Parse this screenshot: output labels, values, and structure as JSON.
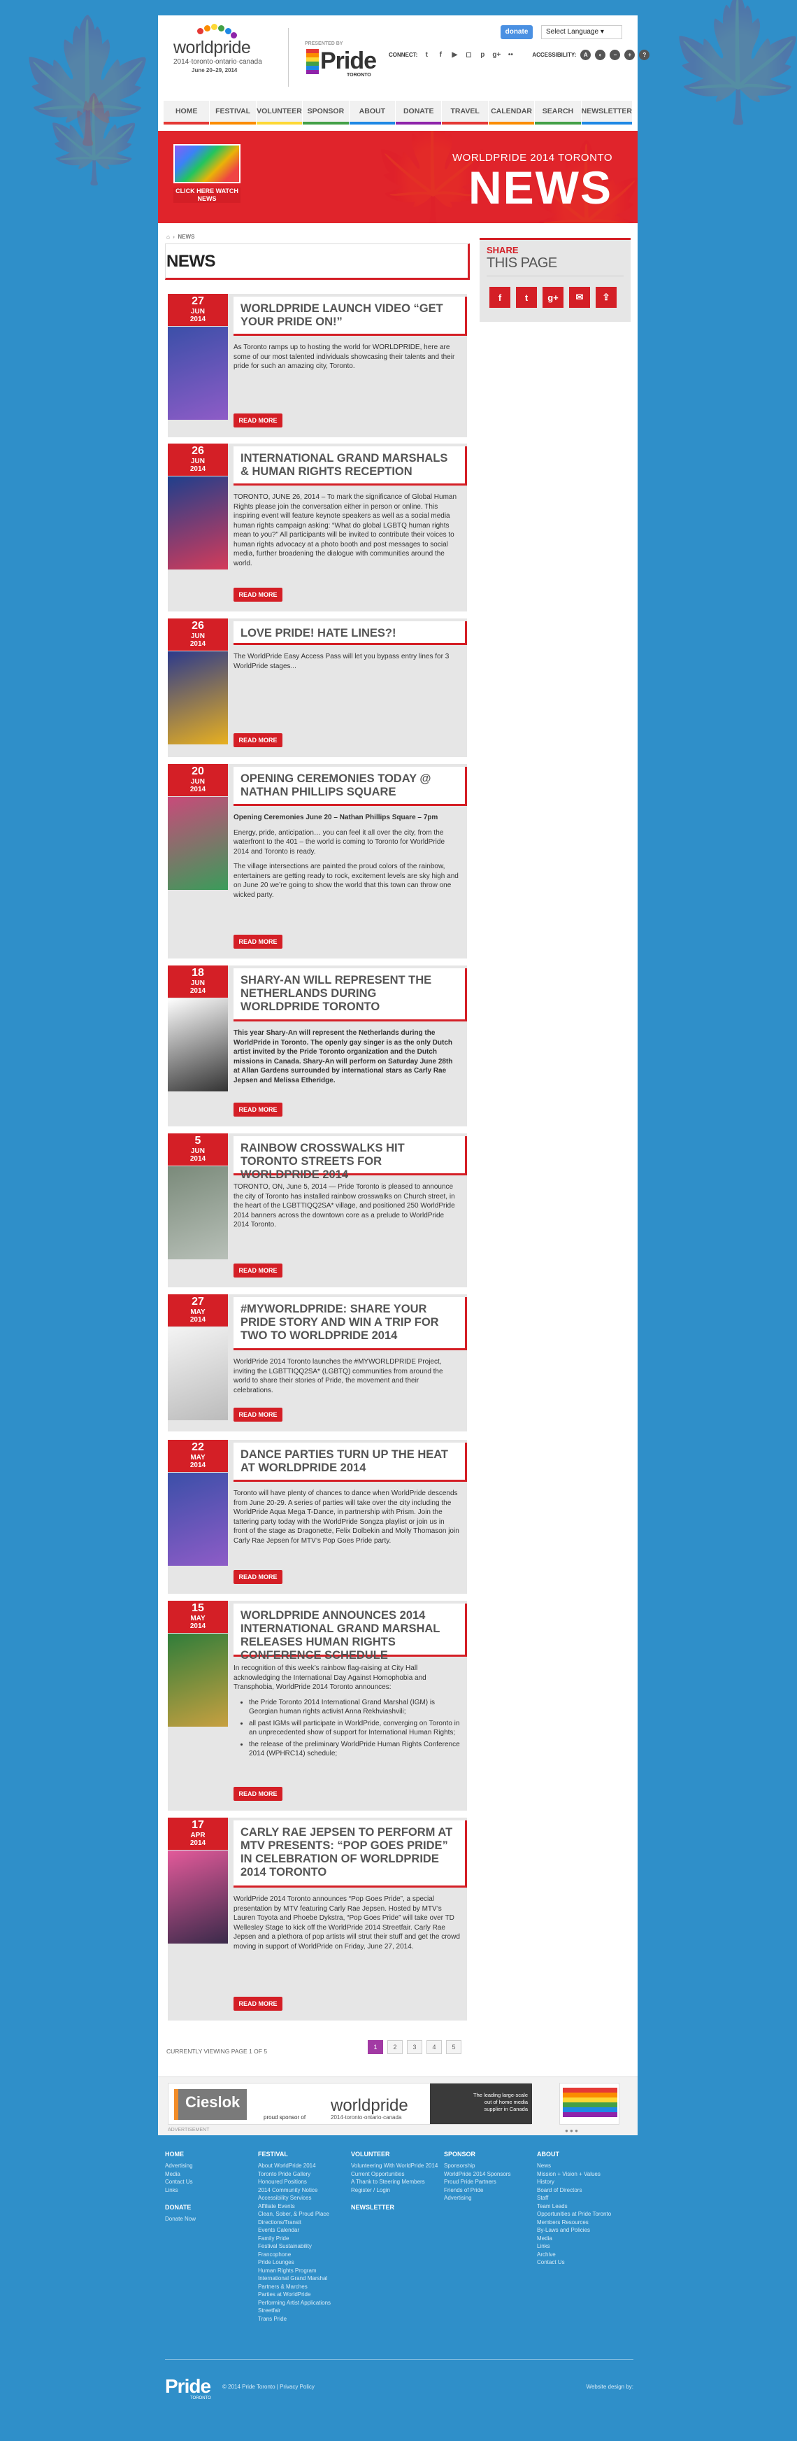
{
  "header": {
    "logo_text": "worldpride",
    "logo_sub": "2014·toronto·ontario·canada",
    "logo_dates": "June 20–29, 2014",
    "presented_by": "PRESENTED BY",
    "pride_logo": "Pride",
    "pride_logo_sub": "TORONTO",
    "donate_label": "donate",
    "language_label": "Select Language",
    "connect_label": "CONNECT:",
    "accessibility_label": "ACCESSIBILITY:"
  },
  "nav": [
    "HOME",
    "FESTIVAL",
    "VOLUNTEER",
    "SPONSOR",
    "ABOUT",
    "DONATE",
    "TRAVEL",
    "CALENDAR",
    "SEARCH",
    "NEWSLETTER"
  ],
  "nav_colors": [
    "#e53935",
    "#fb8c00",
    "#fdd835",
    "#43a047",
    "#1e88e5",
    "#8e24aa",
    "#e53935",
    "#fb8c00",
    "#43a047",
    "#1e88e5"
  ],
  "hero": {
    "kicker": "WORLDPRIDE 2014 TORONTO",
    "title": "NEWS",
    "video_label": "CLICK HERE WATCH NEWS"
  },
  "breadcrumb": "NEWS",
  "page_title": "NEWS",
  "share": {
    "line1": "SHARE",
    "line2": "THIS PAGE",
    "icons": [
      "f",
      "t",
      "g+",
      "✉",
      "⇪"
    ]
  },
  "articles": [
    {
      "day": "27",
      "month": "JUN",
      "year": "2014",
      "title": "WORLDPRIDE LAUNCH VIDEO “GET YOUR PRIDE ON!”",
      "body": [
        "As Toronto ramps up to hosting the world for WORLDPRIDE, here are some of our most talented individuals showcasing their talents and their pride for such an amazing city, Toronto."
      ],
      "read_more": "READ MORE"
    },
    {
      "day": "26",
      "month": "JUN",
      "year": "2014",
      "title": "INTERNATIONAL GRAND MARSHALS & HUMAN RIGHTS RECEPTION",
      "body": [
        "TORONTO, JUNE 26, 2014 – To mark the significance of Global Human Rights please join the conversation either in person or online. This inspiring event will feature keynote speakers as well as a social media human rights campaign asking: “What do global LGBTQ human rights mean to you?” All participants will be invited to contribute their voices to human rights advocacy at a photo booth and post messages to social media, further broadening the dialogue with communities around the world."
      ],
      "read_more": "READ MORE"
    },
    {
      "day": "26",
      "month": "JUN",
      "year": "2014",
      "title": "LOVE PRIDE! HATE LINES?!",
      "body": [
        "The WorldPride Easy Access Pass will let you bypass entry lines for 3 WorldPride stages..."
      ],
      "read_more": "READ MORE"
    },
    {
      "day": "20",
      "month": "JUN",
      "year": "2014",
      "title": "OPENING CEREMONIES TODAY @ NATHAN PHILLIPS SQUARE",
      "body": [
        "Opening Ceremonies June 20 – Nathan Phillips Square – 7pm",
        "Energy, pride, anticipation… you can feel it all over the city, from the waterfront to the 401 – the world is coming to Toronto for WorldPride 2014 and Toronto is ready.",
        "The village intersections are painted the proud colors of the rainbow, entertainers are getting ready to rock, excitement levels are sky high and on June 20 we’re going to show the world that this town can throw one wicked party."
      ],
      "read_more": "READ MORE"
    },
    {
      "day": "18",
      "month": "JUN",
      "year": "2014",
      "title": "SHARY-AN WILL REPRESENT THE NETHERLANDS DURING WORLDPRIDE TORONTO",
      "body": [
        "This year Shary-An will represent the Netherlands during the WorldPride in Toronto. The openly gay singer is as the only Dutch artist invited by the Pride Toronto organization and the Dutch missions in Canada. Shary-An will perform on Saturday June 28th at Allan Gardens surrounded by international stars as Carly Rae Jepsen and Melissa Etheridge."
      ],
      "read_more": "READ MORE"
    },
    {
      "day": "5",
      "month": "JUN",
      "year": "2014",
      "title": "RAINBOW CROSSWALKS HIT TORONTO STREETS FOR WORLDPRIDE 2014",
      "body": [
        "TORONTO, ON, June 5, 2014 — Pride Toronto is pleased to announce the city of Toronto has installed rainbow crosswalks on Church street, in the heart of the LGBTTIQQ2SA* village, and positioned 250 WorldPride 2014 banners across the downtown core as a prelude to WorldPride 2014 Toronto."
      ],
      "read_more": "READ MORE"
    },
    {
      "day": "27",
      "month": "MAY",
      "year": "2014",
      "title": "#MYWORLDPRIDE: SHARE YOUR PRIDE STORY AND WIN A TRIP FOR TWO TO WORLDPRIDE 2014",
      "body": [
        "WorldPride 2014 Toronto launches the #MYWORLDPRIDE Project, inviting the LGBTTIQQ2SA* (LGBTQ) communities from around the world to share their stories of Pride, the movement and their celebrations."
      ],
      "read_more": "READ MORE"
    },
    {
      "day": "22",
      "month": "MAY",
      "year": "2014",
      "title": "DANCE PARTIES TURN UP THE HEAT AT WORLDPRIDE 2014",
      "body": [
        "Toronto will have plenty of chances to dance when WorldPride descends from June 20-29. A series of parties will take over the city including the WorldPride Aqua Mega T-Dance, in partnership with Prism. Join the tattering party today with the WorldPride Songza playlist or join us in front of the stage as Dragonette, Felix Dolbekin and Molly Thomason join Carly Rae Jepsen for MTV’s Pop Goes Pride party."
      ],
      "read_more": "READ MORE"
    },
    {
      "day": "15",
      "month": "MAY",
      "year": "2014",
      "title": "WORLDPRIDE ANNOUNCES 2014 INTERNATIONAL GRAND MARSHAL RELEASES HUMAN RIGHTS CONFERENCE SCHEDULE",
      "body": [
        "In recognition of this week’s rainbow flag-raising at City Hall acknowledging the International Day Against Homophobia and Transphobia, WorldPride 2014 Toronto announces:"
      ],
      "bullets": [
        "the Pride Toronto 2014 International Grand Marshal (IGM) is Georgian human rights activist Anna Rekhviashvili;",
        "all past IGMs will participate in WorldPride, converging on Toronto in an unprecedented show of support for International Human Rights;",
        "the release of the preliminary WorldPride Human Rights Conference 2014 (WPHRC14) schedule;"
      ],
      "read_more": "READ MORE"
    },
    {
      "day": "17",
      "month": "APR",
      "year": "2014",
      "title": "CARLY RAE JEPSEN TO PERFORM AT MTV PRESENTS: “POP GOES PRIDE” IN CELEBRATION OF WORLDPRIDE 2014 TORONTO",
      "body": [
        "WorldPride 2014 Toronto announces “Pop Goes Pride”, a special presentation by MTV featuring Carly Rae Jepsen. Hosted by MTV’s Lauren Toyota and Phoebe Dykstra, “Pop Goes Pride” will take over TD Wellesley Stage to kick off the WorldPride 2014 Streetfair. Carly Rae Jepsen and a plethora of pop artists will strut their stuff and get the crowd moving in support of WorldPride on Friday, June 27, 2014."
      ],
      "read_more": "READ MORE"
    }
  ],
  "pager": {
    "label": "CURRENTLY VIEWING PAGE 1 OF 5",
    "pages": [
      "1",
      "2",
      "3",
      "4",
      "5"
    ],
    "current": "1"
  },
  "ads": {
    "sponsor": "Cieslok",
    "sponsor_sub": "media",
    "proud": "proud sponsor of",
    "wp": "worldpride",
    "wp_sub": "2014·toronto·ontario·canada",
    "tagline": "The leading large-scale out of home media supplier in Canada",
    "advert_label": "ADVERTISEMENT"
  },
  "footer": {
    "cols": [
      {
        "title": "HOME",
        "items": [
          "Advertising",
          "Media",
          "Contact Us",
          "Links"
        ],
        "title2": "DONATE",
        "items2": [
          "Donate Now"
        ]
      },
      {
        "title": "FESTIVAL",
        "items": [
          "About WorldPride 2014",
          "Toronto Pride Gallery",
          "Honoured Positions",
          "2014 Community Notice",
          "Accessibility Services",
          "Affiliate Events",
          "Clean, Sober, & Proud Place",
          "Directions/Transit",
          "Events Calendar",
          "Family Pride",
          "Festival Sustainability",
          "Francophone",
          "Pride Lounges",
          "Human Rights Program",
          "International Grand Marshal",
          "Partners & Marches",
          "Parties at WorldPride",
          "Performing Artist Applications",
          "Streetfair",
          "Trans Pride"
        ]
      },
      {
        "title": "VOLUNTEER",
        "items": [
          "Volunteering With WorldPride 2014",
          "Current Opportunities",
          "A Thank to Steering Members",
          "Register / Login"
        ],
        "title2": "NEWSLETTER",
        "items2": []
      },
      {
        "title": "SPONSOR",
        "items": [
          "Sponsorship",
          "WorldPride 2014 Sponsors",
          "Proud Pride Partners",
          "Friends of Pride",
          "Advertising"
        ]
      },
      {
        "title": "ABOUT",
        "items": [
          "News",
          "Mission + Vision + Values",
          "History",
          "Board of Directors",
          "Staff",
          "Team Leads",
          "Opportunities at Pride Toronto",
          "Members Resources",
          "By-Laws and Policies",
          "Media",
          "Links",
          "Archive",
          "Contact Us"
        ]
      }
    ],
    "pride": "Pride",
    "pride_sub": "TORONTO",
    "copyright": "© 2014 Pride Toronto   |   Privacy Policy",
    "design": "Website design by:"
  }
}
